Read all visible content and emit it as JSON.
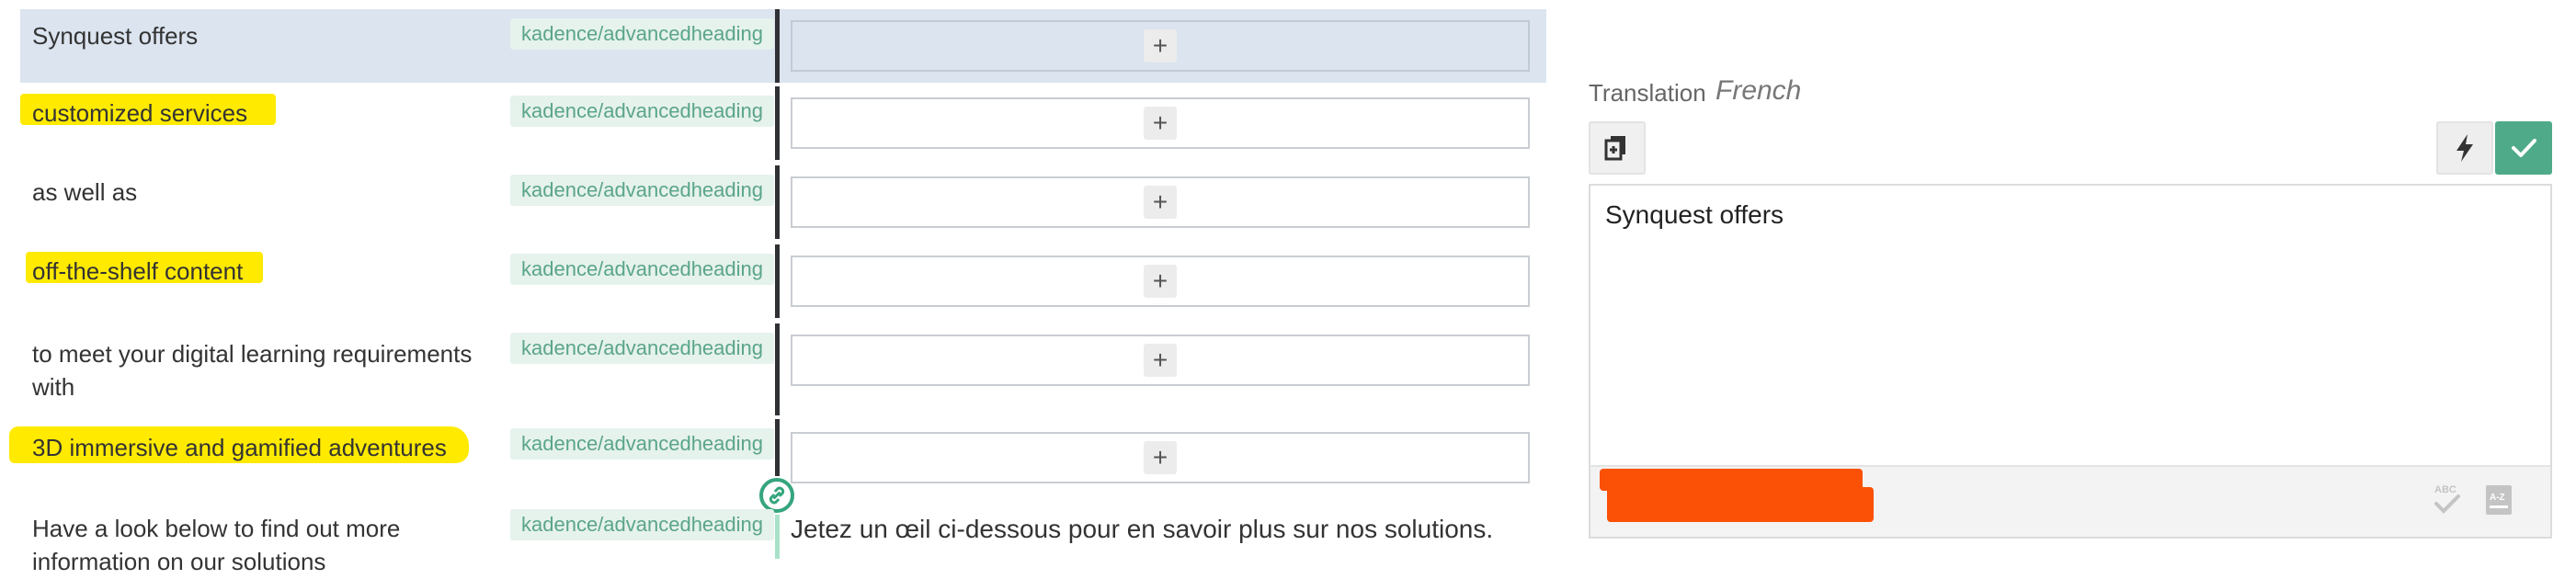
{
  "segments": [
    {
      "source": "Synquest offers",
      "tag": "kadence/advancedheading",
      "highlighted": false,
      "active": true,
      "target_button": "+"
    },
    {
      "source": "customized services",
      "tag": "kadence/advancedheading",
      "highlighted": true,
      "active": false,
      "target_button": "+"
    },
    {
      "source": "as well as",
      "tag": "kadence/advancedheading",
      "highlighted": false,
      "active": false,
      "target_button": "+"
    },
    {
      "source": "off-the-shelf content",
      "tag": "kadence/advancedheading",
      "highlighted": true,
      "active": false,
      "target_button": "+"
    },
    {
      "source_line1": "to meet your digital learning requirements",
      "source_line2": "with",
      "tag": "kadence/advancedheading",
      "highlighted": false,
      "active": false,
      "target_button": "+"
    },
    {
      "source": "3D immersive and gamified adventures",
      "tag": "kadence/advancedheading",
      "highlighted": true,
      "active": false,
      "target_button": "+"
    },
    {
      "source_line1": "Have a look below to find out more",
      "source_line2": "information on our solutions",
      "tag": "kadence/advancedheading",
      "target_text": "Jetez un œil ci-dessous pour en savoir plus sur nos solutions."
    }
  ],
  "translation_panel": {
    "label": "Translation",
    "language": "French",
    "editor_text": "Synquest offers",
    "icons": [
      "copy-source-icon",
      "flash-icon",
      "check-icon",
      "spellcheck-icon",
      "glossary-icon",
      "link-icon"
    ]
  },
  "colors": {
    "highlight": "#ffea00",
    "accent_green": "#4faa89",
    "active_row": "#dbe4ef",
    "tag_bg": "#e6f2ec",
    "tag_text": "#5aa58a",
    "redaction": "#fb5106"
  }
}
